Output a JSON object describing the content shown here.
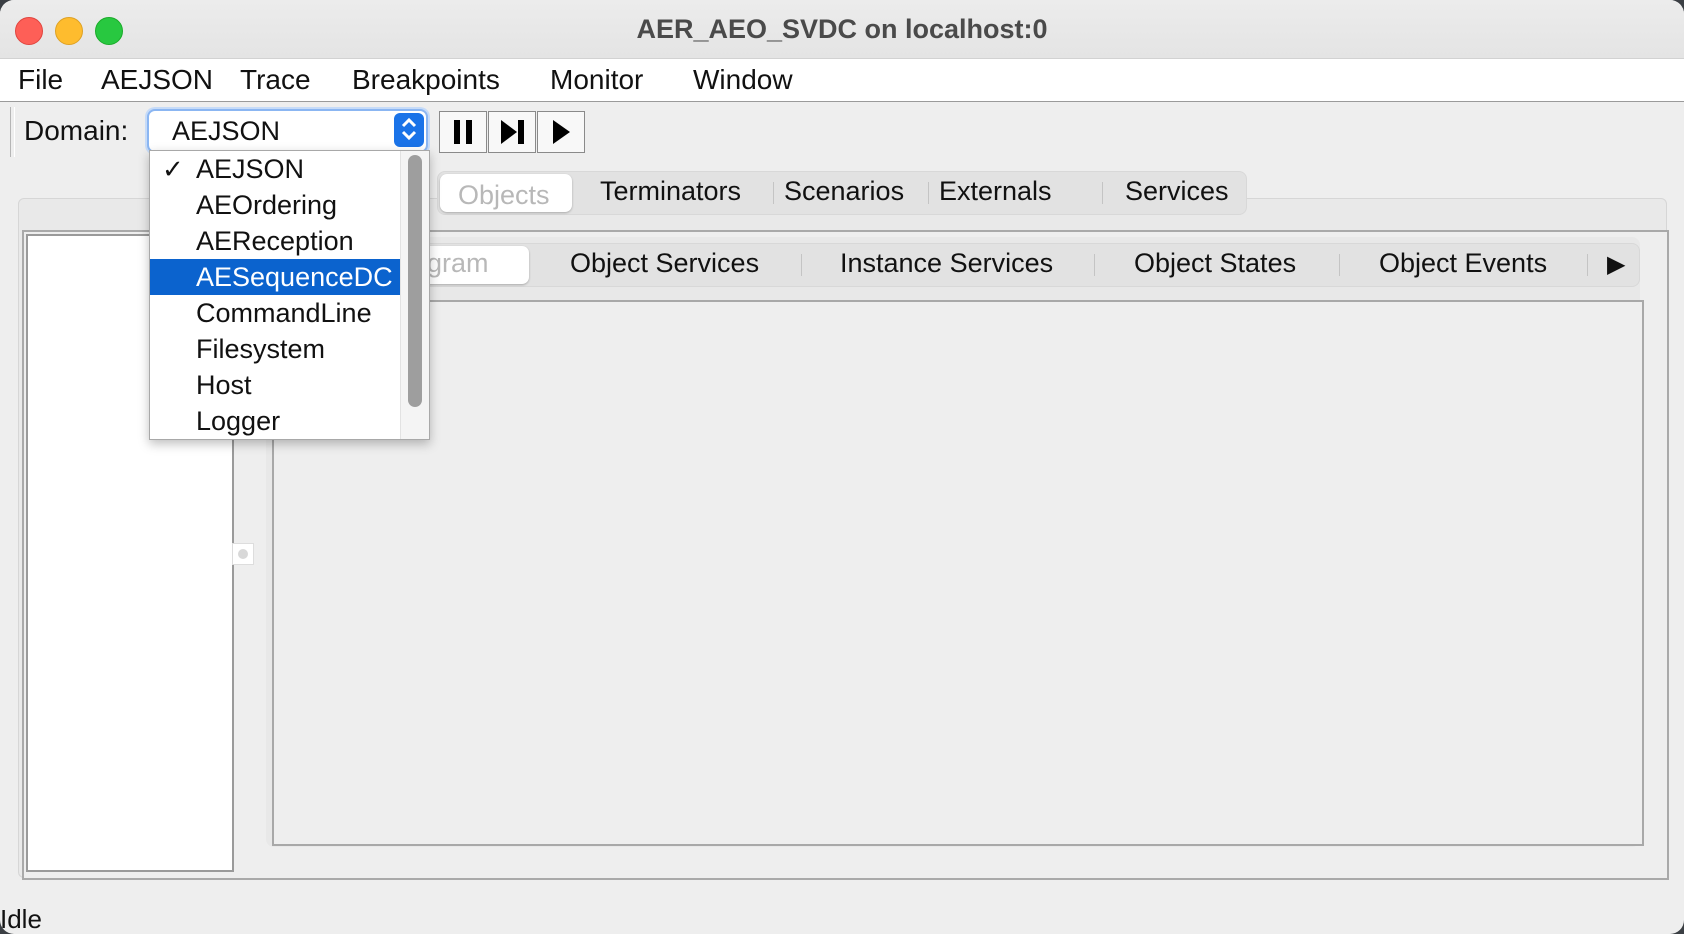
{
  "window": {
    "title": "AER_AEO_SVDC on localhost:0"
  },
  "menu": [
    "File",
    "AEJSON",
    "Trace",
    "Breakpoints",
    "Monitor",
    "Window"
  ],
  "toolbar": {
    "domain_label": "Domain:",
    "domain_value": "AEJSON",
    "buttons": [
      "pause-icon",
      "step-icon",
      "run-icon"
    ]
  },
  "domain_dropdown": {
    "options": [
      "AEJSON",
      "AEOrdering",
      "AEReception",
      "AESequenceDC",
      "CommandLine",
      "Filesystem",
      "Host",
      "Logger"
    ],
    "checked": "AEJSON",
    "highlighted": "AESequenceDC"
  },
  "tabs_top": {
    "items": [
      "Objects",
      "Terminators",
      "Scenarios",
      "Externals",
      "Services"
    ],
    "selected": "Objects"
  },
  "tabs_second": {
    "partial_first": "gram",
    "items": [
      "Object Services",
      "Instance Services",
      "Object States",
      "Object Events"
    ]
  },
  "status": "Idle",
  "colors": {
    "highlight": "#0b63ce",
    "combo_accent": "#1a73e8"
  }
}
